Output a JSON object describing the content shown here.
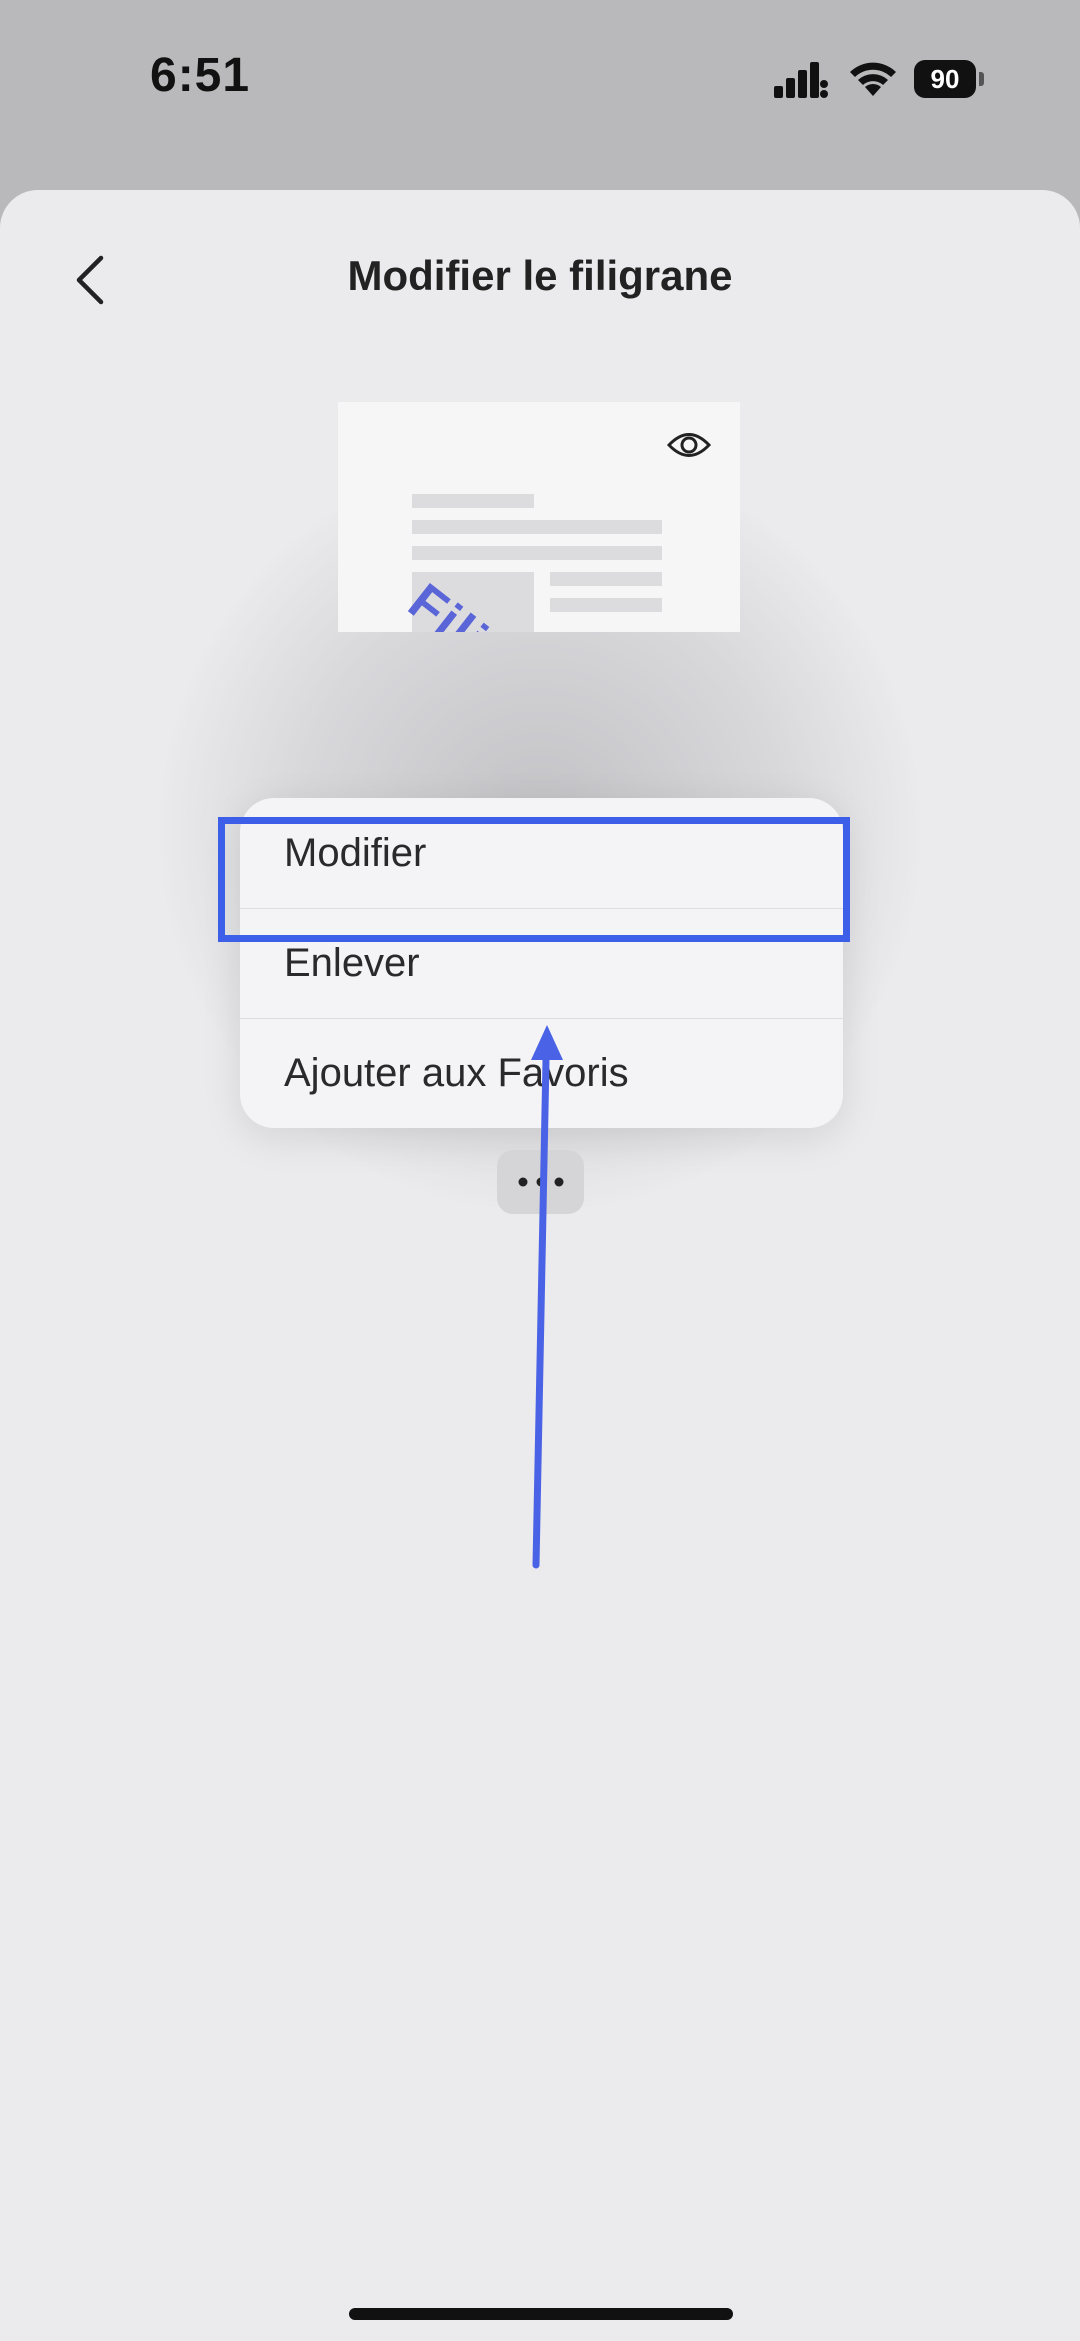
{
  "status_bar": {
    "time": "6:51",
    "battery_level": "90",
    "icons": [
      "signal-icon",
      "wifi-icon",
      "battery-icon"
    ]
  },
  "header": {
    "title": "Modifier le filigrane",
    "back_icon": "chevron-left-icon"
  },
  "preview": {
    "watermark_text": "Fili",
    "watermark_color": "#5a66d8",
    "icon": "eye-icon"
  },
  "context_menu": {
    "items": [
      {
        "label": "Modifier"
      },
      {
        "label": "Enlever"
      },
      {
        "label": "Ajouter aux Favoris"
      }
    ]
  },
  "more_button": {
    "icon": "ellipsis-icon"
  },
  "annotation": {
    "highlight_color": "#3d5ee8",
    "highlighted_item": "Ajouter aux Favoris"
  }
}
